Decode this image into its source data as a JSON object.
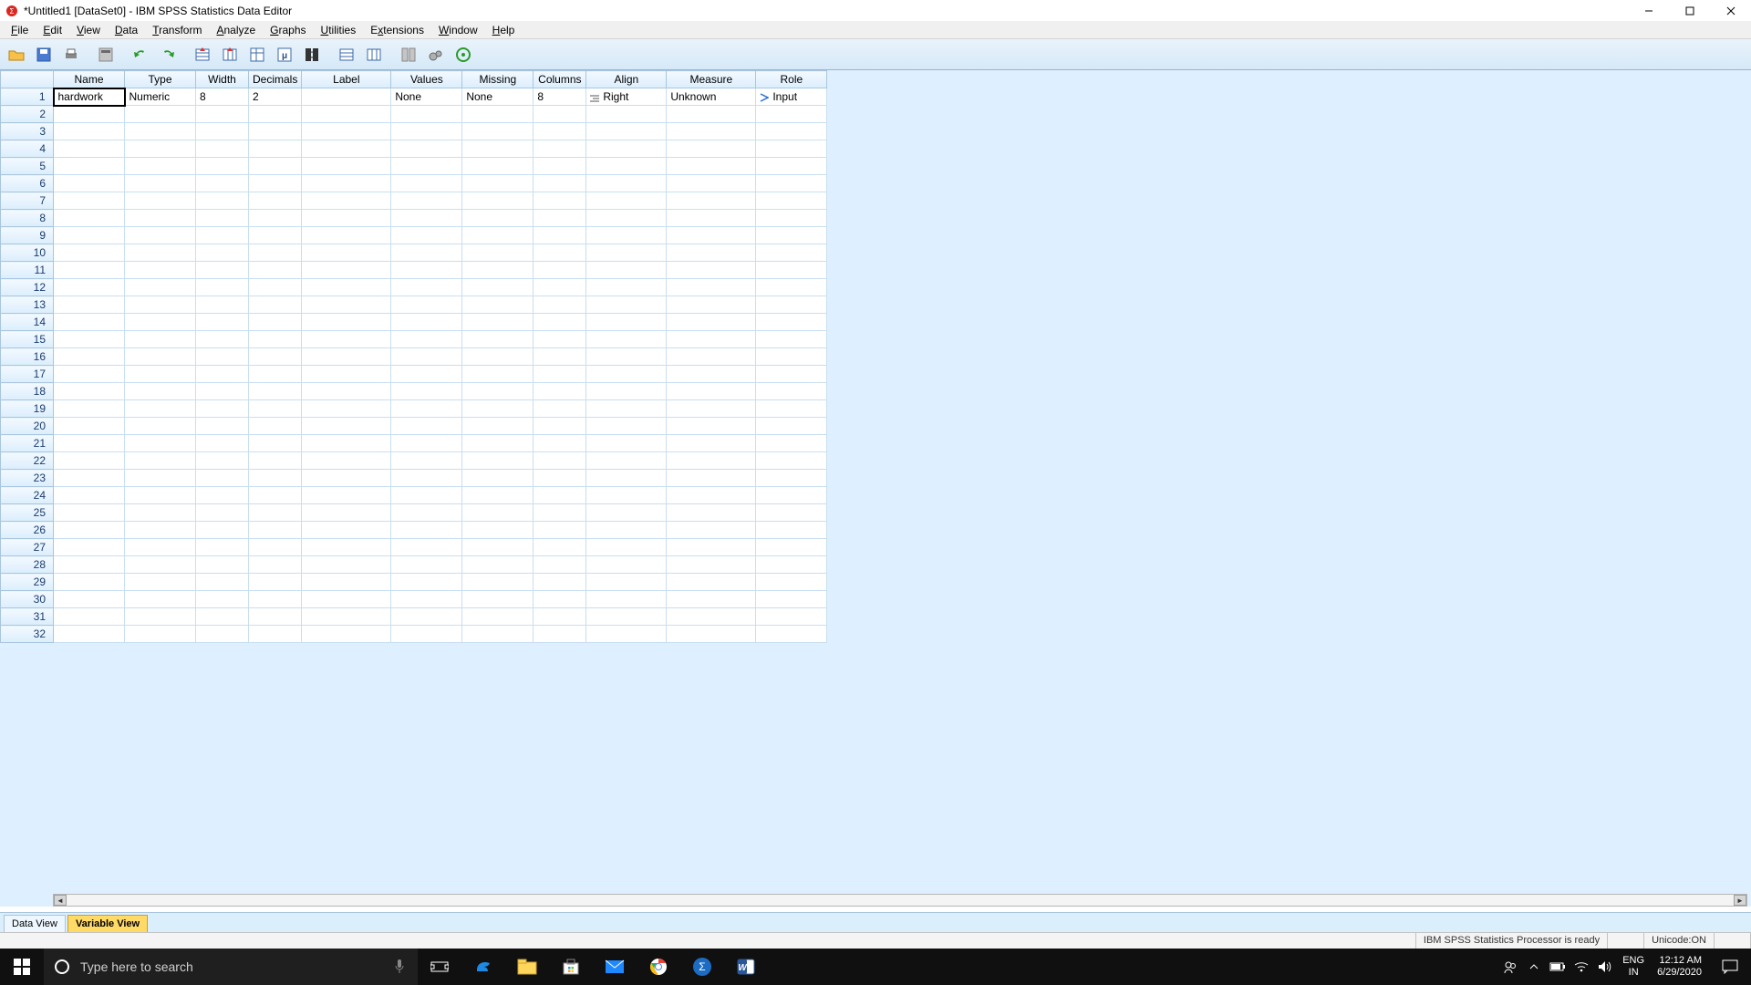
{
  "window": {
    "title": "*Untitled1 [DataSet0] - IBM SPSS Statistics Data Editor"
  },
  "menu": {
    "items": [
      "File",
      "Edit",
      "View",
      "Data",
      "Transform",
      "Analyze",
      "Graphs",
      "Utilities",
      "Extensions",
      "Window",
      "Help"
    ]
  },
  "toolbar": {
    "buttons": [
      "open",
      "save",
      "print",
      "recall",
      "undo",
      "redo",
      "goto-case",
      "goto-var",
      "variables",
      "find",
      "insert-case",
      "split",
      "weight",
      "select",
      "value-labels",
      "use-sets",
      "show-all"
    ]
  },
  "grid": {
    "columns": [
      {
        "key": "name",
        "label": "Name"
      },
      {
        "key": "type",
        "label": "Type"
      },
      {
        "key": "width",
        "label": "Width"
      },
      {
        "key": "decimals",
        "label": "Decimals"
      },
      {
        "key": "label",
        "label": "Label"
      },
      {
        "key": "values",
        "label": "Values"
      },
      {
        "key": "missing",
        "label": "Missing"
      },
      {
        "key": "columns",
        "label": "Columns"
      },
      {
        "key": "align",
        "label": "Align"
      },
      {
        "key": "measure",
        "label": "Measure"
      },
      {
        "key": "role",
        "label": "Role"
      }
    ],
    "rows": [
      {
        "name": "hardwork",
        "type": "Numeric",
        "width": "8",
        "decimals": "2",
        "label": "",
        "values": "None",
        "missing": "None",
        "columns": "8",
        "align": "Right",
        "measure": "Unknown",
        "role": "Input"
      }
    ],
    "visible_row_count": 32
  },
  "tabs": {
    "data_view": "Data View",
    "variable_view": "Variable View",
    "active": "variable_view"
  },
  "status": {
    "processor": "IBM SPSS Statistics Processor is ready",
    "unicode": "Unicode:ON"
  },
  "taskbar": {
    "search_placeholder": "Type here to search",
    "lang1": "ENG",
    "lang2": "IN",
    "time": "12:12 AM",
    "date": "6/29/2020"
  }
}
